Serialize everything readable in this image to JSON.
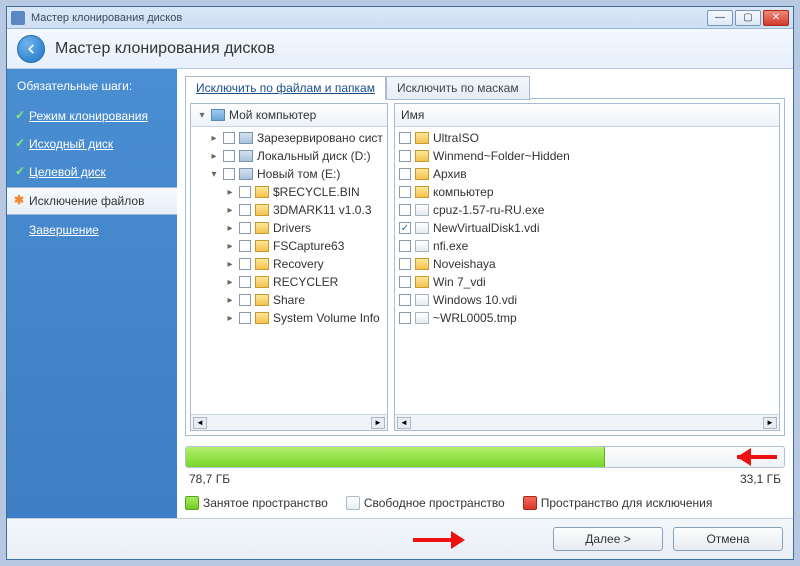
{
  "window": {
    "title": "Мастер клонирования дисков"
  },
  "header": {
    "title": "Мастер клонирования дисков"
  },
  "sidebar": {
    "heading": "Обязательные шаги:",
    "items": [
      {
        "label": "Режим клонирования"
      },
      {
        "label": "Исходный диск"
      },
      {
        "label": "Целевой диск"
      },
      {
        "label": "Исключение файлов"
      },
      {
        "label": "Завершение"
      }
    ]
  },
  "tabs": {
    "active": "Исключить по файлам и папкам",
    "inactive": "Исключить по маскам"
  },
  "left_pane": {
    "header": "Мой компьютер",
    "rows": [
      {
        "indent": 1,
        "twisty": "▸",
        "checked": false,
        "icon": "drive",
        "label": "Зарезервировано сист"
      },
      {
        "indent": 1,
        "twisty": "▸",
        "checked": false,
        "icon": "drive",
        "label": "Локальный диск (D:)"
      },
      {
        "indent": 1,
        "twisty": "▾",
        "checked": false,
        "icon": "drive",
        "label": "Новый том (E:)"
      },
      {
        "indent": 2,
        "twisty": "▸",
        "checked": false,
        "icon": "folder",
        "label": "$RECYCLE.BIN"
      },
      {
        "indent": 2,
        "twisty": "▸",
        "checked": false,
        "icon": "folder",
        "label": "3DMARK11 v1.0.3"
      },
      {
        "indent": 2,
        "twisty": "▸",
        "checked": false,
        "icon": "folder",
        "label": "Drivers"
      },
      {
        "indent": 2,
        "twisty": "▸",
        "checked": false,
        "icon": "folder",
        "label": "FSCapture63"
      },
      {
        "indent": 2,
        "twisty": "▸",
        "checked": false,
        "icon": "folder",
        "label": "Recovery"
      },
      {
        "indent": 2,
        "twisty": "▸",
        "checked": false,
        "icon": "folder",
        "label": "RECYCLER"
      },
      {
        "indent": 2,
        "twisty": "▸",
        "checked": false,
        "icon": "folder",
        "label": "Share"
      },
      {
        "indent": 2,
        "twisty": "▸",
        "checked": false,
        "icon": "folder",
        "label": "System Volume Info"
      }
    ]
  },
  "right_pane": {
    "header": "Имя",
    "rows": [
      {
        "checked": false,
        "icon": "folder",
        "label": "UltraISO"
      },
      {
        "checked": false,
        "icon": "folder",
        "label": "Winmend~Folder~Hidden"
      },
      {
        "checked": false,
        "icon": "folder",
        "label": "Архив"
      },
      {
        "checked": false,
        "icon": "folder",
        "label": "компьютер"
      },
      {
        "checked": false,
        "icon": "file",
        "label": "cpuz-1.57-ru-RU.exe"
      },
      {
        "checked": true,
        "icon": "file",
        "label": "NewVirtualDisk1.vdi"
      },
      {
        "checked": false,
        "icon": "file",
        "label": "nfi.exe"
      },
      {
        "checked": false,
        "icon": "folder",
        "label": "Noveishaya"
      },
      {
        "checked": false,
        "icon": "folder",
        "label": "Win 7_vdi"
      },
      {
        "checked": false,
        "icon": "file",
        "label": "Windows 10.vdi"
      },
      {
        "checked": false,
        "icon": "file",
        "label": "~WRL0005.tmp"
      }
    ]
  },
  "capacity": {
    "used_label": "78,7 ГБ",
    "free_label": "33,1 ГБ",
    "used_percent": 70
  },
  "legend": {
    "used": "Занятое пространство",
    "free": "Свободное пространство",
    "excl": "Пространство для исключения"
  },
  "footer": {
    "next": "Далее >",
    "cancel": "Отмена"
  }
}
